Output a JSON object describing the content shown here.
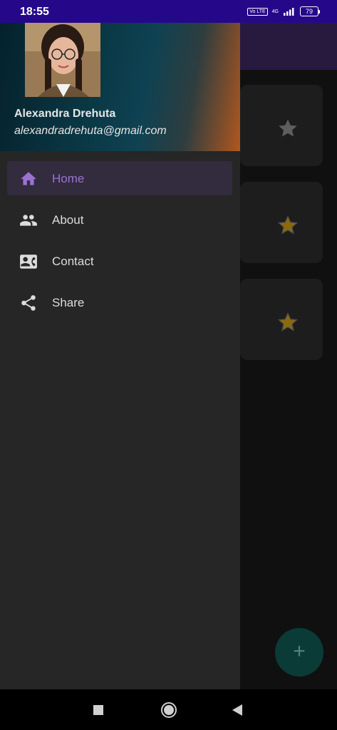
{
  "status_bar": {
    "time": "18:55",
    "volte": "Vo LTE",
    "network": "4G",
    "battery": "79"
  },
  "drawer": {
    "profile_name": "Alexandra Drehuta",
    "profile_email": "alexandradrehuta@gmail.com",
    "menu": [
      {
        "label": "Home",
        "icon": "home-icon",
        "active": true
      },
      {
        "label": "About",
        "icon": "people-icon",
        "active": false
      },
      {
        "label": "Contact",
        "icon": "contact-card-icon",
        "active": false
      },
      {
        "label": "Share",
        "icon": "share-icon",
        "active": false
      }
    ]
  },
  "background_cards": [
    {
      "starred": false
    },
    {
      "starred": true
    },
    {
      "starred": true
    }
  ],
  "fab": {
    "label": "+"
  },
  "colors": {
    "status_bar": "#25088a",
    "accent": "#9b72cf",
    "drawer_bg": "#262626",
    "star_active": "#8a6a10",
    "star_inactive": "#5e5e5e"
  }
}
